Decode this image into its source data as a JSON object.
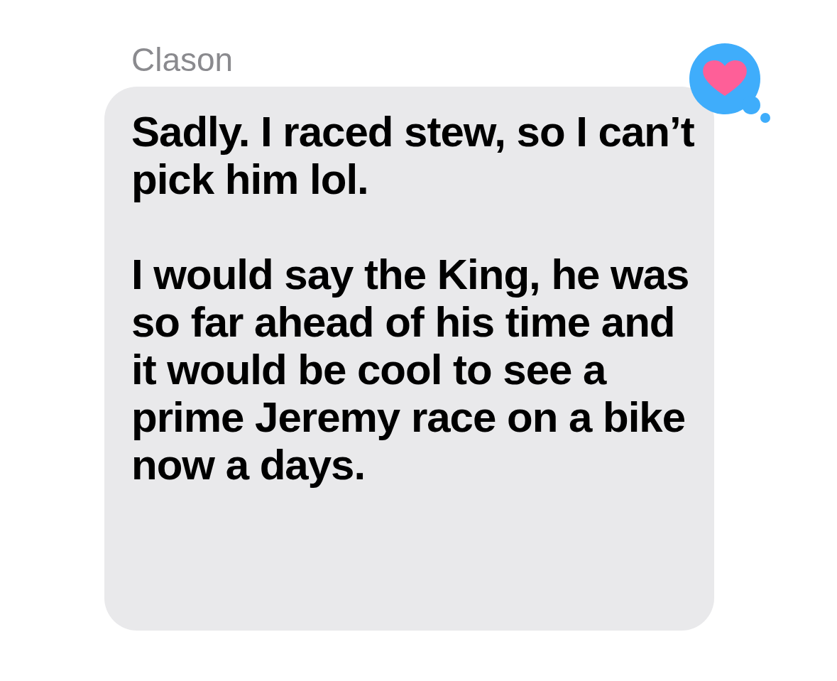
{
  "message": {
    "sender": "Clason",
    "paragraphs": [
      "Sadly. I raced stew, so I can’t pick him lol.",
      "I would say the King, he was so far ahead of his time and it would be cool to see a prime Jeremy race on a bike now a days."
    ],
    "reaction": {
      "kind": "heart"
    }
  }
}
